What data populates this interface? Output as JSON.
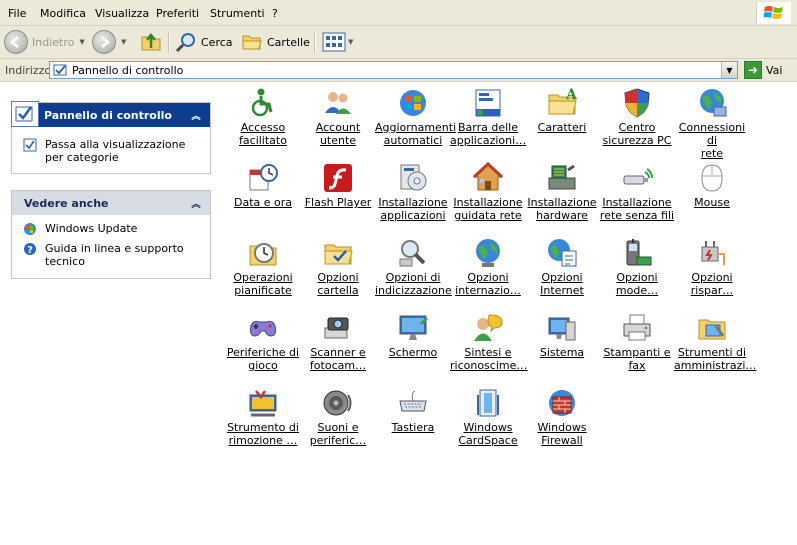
{
  "menu": [
    "File",
    "Modifica",
    "Visualizza",
    "Preferiti",
    "Strumenti",
    "?"
  ],
  "toolbar": {
    "back_label": "Indietro",
    "search_label": "Cerca",
    "folders_label": "Cartelle"
  },
  "address": {
    "label": "Indirizzo",
    "value": "Pannello di controllo",
    "go_label": "Vai"
  },
  "task_panel": {
    "title": "Pannello di controllo",
    "link": "Passa alla visualizzazione per categorie"
  },
  "see_also": {
    "title": "Vedere anche",
    "links": [
      "Windows Update",
      "Guida in linea e supporto tecnico"
    ]
  },
  "items": [
    {
      "line1": "Accesso",
      "line2": "facilitato",
      "icon": "accessibility-icon"
    },
    {
      "line1": "Account",
      "line2": "utente",
      "icon": "user-accounts-icon"
    },
    {
      "line1": "Aggiornamenti",
      "line2": "automatici",
      "icon": "windows-update-icon"
    },
    {
      "line1": "Barra delle",
      "line2": "applicazioni…",
      "icon": "taskbar-icon"
    },
    {
      "line1": "Caratteri",
      "line2": "",
      "icon": "fonts-folder-icon"
    },
    {
      "line1": "Centro",
      "line2": "sicurezza PC",
      "icon": "security-shield-icon"
    },
    {
      "line1": "Connessioni di",
      "line2": "rete",
      "icon": "network-globe-icon"
    },
    {
      "line1": "Data e ora",
      "line2": "",
      "icon": "date-time-icon"
    },
    {
      "line1": "Flash Player",
      "line2": "",
      "icon": "flash-icon"
    },
    {
      "line1": "Installazione",
      "line2": "applicazioni",
      "icon": "install-apps-icon"
    },
    {
      "line1": "Installazione",
      "line2": "guidata rete",
      "icon": "home-network-icon"
    },
    {
      "line1": "Installazione",
      "line2": "hardware",
      "icon": "hardware-icon"
    },
    {
      "line1": "Installazione",
      "line2": "rete senza fili",
      "icon": "wireless-icon"
    },
    {
      "line1": "Mouse",
      "line2": "",
      "icon": "mouse-icon"
    },
    {
      "line1": "Operazioni",
      "line2": "pianificate",
      "icon": "scheduled-tasks-icon"
    },
    {
      "line1": "Opzioni",
      "line2": "cartella",
      "icon": "folder-options-icon"
    },
    {
      "line1": "Opzioni di",
      "line2": "indicizzazione",
      "icon": "indexing-icon"
    },
    {
      "line1": "Opzioni",
      "line2": "internazio…",
      "icon": "regional-globe-icon"
    },
    {
      "line1": "Opzioni",
      "line2": "Internet",
      "icon": "internet-options-icon"
    },
    {
      "line1": "Opzioni",
      "line2": "mode…",
      "icon": "phone-modem-icon"
    },
    {
      "line1": "Opzioni",
      "line2": "rispar…",
      "icon": "power-icon"
    },
    {
      "line1": "Periferiche di",
      "line2": "gioco",
      "icon": "gamepad-icon"
    },
    {
      "line1": "Scanner e",
      "line2": "fotocam…",
      "icon": "scanner-camera-icon"
    },
    {
      "line1": "Schermo",
      "line2": "",
      "icon": "display-icon"
    },
    {
      "line1": "Sintesi e",
      "line2": "riconoscime…",
      "icon": "speech-icon"
    },
    {
      "line1": "Sistema",
      "line2": "",
      "icon": "system-icon"
    },
    {
      "line1": "Stampanti e",
      "line2": "fax",
      "icon": "printer-icon"
    },
    {
      "line1": "Strumenti di",
      "line2": "amministrazi…",
      "icon": "admin-tools-icon"
    },
    {
      "line1": "Strumento di",
      "line2": "rimozione …",
      "icon": "removal-tool-icon"
    },
    {
      "line1": "Suoni e",
      "line2": "periferic…",
      "icon": "speaker-icon"
    },
    {
      "line1": "Tastiera",
      "line2": "",
      "icon": "keyboard-icon"
    },
    {
      "line1": "Windows",
      "line2": "CardSpace",
      "icon": "cardspace-icon"
    },
    {
      "line1": "Windows",
      "line2": "Firewall",
      "icon": "firewall-icon"
    }
  ]
}
